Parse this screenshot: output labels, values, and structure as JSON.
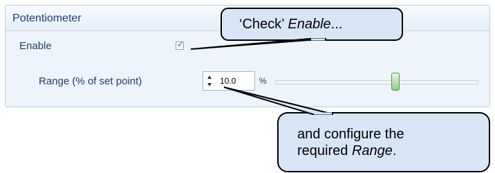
{
  "panel": {
    "title": "Potentiometer",
    "enable_label": "Enable",
    "enable_checked": true,
    "range_label": "Range (% of set point)",
    "range_value": "10.0",
    "range_unit": "%",
    "slider_level": 0.6
  },
  "callouts": {
    "top": {
      "part1": "‘Check’ ",
      "part2": "Enable",
      "part3": "..."
    },
    "bottom": {
      "line1": "and configure the",
      "line2_part1": "required ",
      "line2_part2": "Range",
      "line2_part3": "."
    }
  },
  "colors": {
    "panel_background": "#eef4fb",
    "callout_fill": "#d7e6f5",
    "label_text": "#1f3d6b",
    "slider_thumb": "#8bcf7c"
  }
}
